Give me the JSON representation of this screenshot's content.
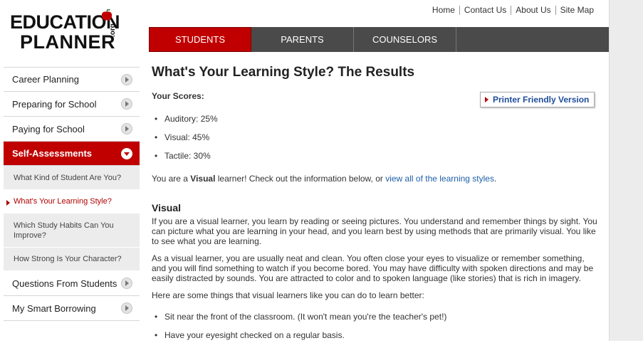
{
  "logo": {
    "line1": "EDUCATION",
    "line2": "PLANNER",
    "suffix": ".org"
  },
  "top_links": [
    "Home",
    "Contact Us",
    "About Us",
    "Site Map"
  ],
  "tabs": [
    {
      "label": "STUDENTS",
      "active": true
    },
    {
      "label": "PARENTS",
      "active": false
    },
    {
      "label": "COUNSELORS",
      "active": false
    }
  ],
  "sidebar": {
    "items_before": [
      "Career Planning",
      "Preparing for School",
      "Paying for School"
    ],
    "active": "Self-Assessments",
    "sub_items": [
      "What Kind of Student Are You?",
      "What's Your Learning Style?",
      "Which Study Habits Can You Improve?",
      "How Strong Is Your Character?"
    ],
    "items_after": [
      "Questions From Students",
      "My Smart Borrowing"
    ]
  },
  "main": {
    "title": "What's Your Learning Style? The Results",
    "scores_label": "Your Scores:",
    "printer_label": "Printer Friendly Version",
    "scores": [
      "Auditory: 25%",
      "Visual: 45%",
      "Tactile: 30%"
    ],
    "result_prefix": "You are a ",
    "result_style": "Visual",
    "result_mid": " learner! Check out the information below, or ",
    "result_link": "view all of the learning styles",
    "result_end": ".",
    "section_heading": "Visual",
    "para1": "If you are a visual learner, you learn by reading or seeing pictures. You understand and remember things by sight. You can picture what you are learning in your head, and you learn best by using methods that are primarily visual. You like to see what you are learning.",
    "para2": "As a visual learner, you are usually neat and clean. You often close your eyes to visualize or remember something, and you will find something to watch if you become bored. You may have difficulty with spoken directions and may be easily distracted by sounds. You are attracted to color and to spoken language (like stories) that is rich in imagery.",
    "para3": "Here are some things that visual learners like you can do to learn better:",
    "tips": [
      "Sit near the front of the classroom. (It won't mean you're the teacher's pet!)",
      "Have your eyesight checked on a regular basis."
    ]
  },
  "colors": {
    "brand_red": "#c00000",
    "tab_gray": "#4a4a4a",
    "link_blue": "#1e5fa8"
  }
}
